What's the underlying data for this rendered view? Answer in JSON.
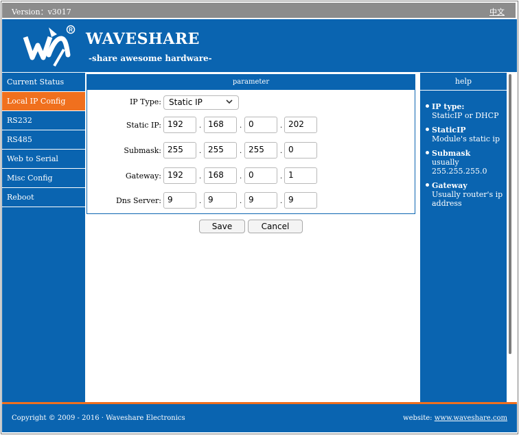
{
  "topbar": {
    "version": "Version：v3017",
    "lang_link": "中文"
  },
  "header": {
    "brand": "WAVESHARE",
    "tagline": "-share awesome hardware-"
  },
  "sidebar": {
    "items": [
      {
        "label": "Current Status"
      },
      {
        "label": "Local IP Config"
      },
      {
        "label": "RS232"
      },
      {
        "label": "RS485"
      },
      {
        "label": "Web to Serial"
      },
      {
        "label": "Misc Config"
      },
      {
        "label": "Reboot"
      }
    ],
    "active_index": 1
  },
  "panel": {
    "title": "parameter",
    "ip_type": {
      "label": "IP Type:",
      "value": "Static IP"
    },
    "static_ip": {
      "label": "Static IP:",
      "values": [
        "192",
        "168",
        "0",
        "202"
      ]
    },
    "submask": {
      "label": "Submask:",
      "values": [
        "255",
        "255",
        "255",
        "0"
      ]
    },
    "gateway": {
      "label": "Gateway:",
      "values": [
        "192",
        "168",
        "0",
        "1"
      ]
    },
    "dns": {
      "label": "Dns Server:",
      "values": [
        "9",
        "9",
        "9",
        "9"
      ]
    },
    "separator": "."
  },
  "buttons": {
    "save": "Save",
    "cancel": "Cancel"
  },
  "help": {
    "title": "help",
    "items": [
      {
        "term": "IP type:",
        "desc": "StaticIP or DHCP"
      },
      {
        "term": "StaticIP",
        "desc": "Module's static ip"
      },
      {
        "term": "Submask",
        "desc": "usually 255.255.255.0"
      },
      {
        "term": "Gateway",
        "desc": "Usually router's ip address"
      }
    ]
  },
  "footer": {
    "copyright": "Copyright © 2009 - 2016 · Waveshare Electronics",
    "website_label": "website:",
    "website_link": "www.waveshare.com"
  },
  "colors": {
    "primary": "#0a64b0",
    "accent": "#f0701e",
    "topbar": "#8c8c8c"
  },
  "icons": {
    "logo": "waveshare-logo",
    "select": "chevron-down-icon"
  }
}
